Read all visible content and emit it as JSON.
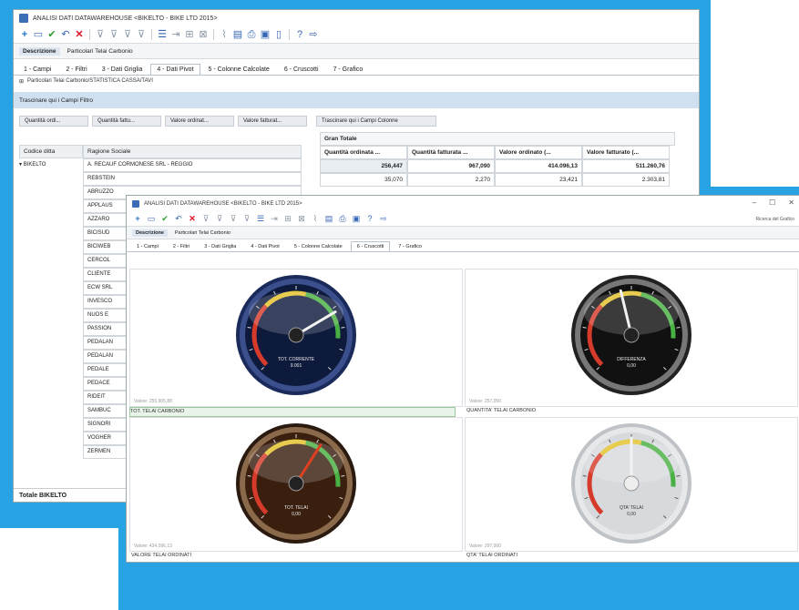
{
  "window1": {
    "title": "ANALISI DATI DATAWAREHOUSE <BIKELTO - BIKE LTD 2015>",
    "description_label": "Descrizione",
    "description_value": "Particolari Telai Carbonio",
    "tabs": [
      "1 - Campi",
      "2 - Filtri",
      "3 - Dati Griglia",
      "4 - Dati Pivot",
      "5 - Colonne Calcolate",
      "6 - Cruscotti",
      "7 - Grafico"
    ],
    "active_tab": 3,
    "info_line": "Particolari Telai Carbonio/STATISTICA CASSA/TAVI",
    "row_drop_zone": "Trascinare qui i Campi Filtro",
    "field_chips": [
      "Quantità ordi...",
      "Quantità fattu...",
      "Valore ordinat...",
      "Valore fatturat..."
    ],
    "column_drop_zone": "Trascinare qui i Campi Colonne",
    "row_headers": [
      "Codice ditta",
      "Ragione Sociale"
    ],
    "grand_total_label": "Gran Totale",
    "column_headers": [
      "Quantità ordinata ...",
      "Quantità fatturata ...",
      "Valore ordinato (...",
      "Valore fatturato (..."
    ],
    "group_label": "BIKELTO",
    "first_row_name": "A. RECAUF CORMONESE SRL - REGGIO",
    "first_row_values": [
      "256,447",
      "967,090",
      "414.096,13",
      "511.260,76"
    ],
    "second_row_values": [
      "35,070",
      "2,270",
      "23,421",
      "2.303,81"
    ],
    "customer_rows": [
      "REBSTEIN",
      "ABRUZZO",
      "APPLAUS",
      "AZZARO",
      "BICISUD",
      "BICIWEB",
      "CERCOL",
      "CLIENTE",
      "ECW SRL",
      "INVESCO",
      "NUOS E",
      "PASSION",
      "PEDALAN",
      "PEDALAN",
      "PEDALE",
      "PEDACE",
      "RIDEIT",
      "SAMBUC",
      "SIGNORI",
      "VOGHER",
      "ZERMEN"
    ],
    "total_label": "Totale BIKELTO"
  },
  "window2": {
    "title": "ANALISI DATI DATAWAREHOUSE <BIKELTO - BIKE LTD 2015>",
    "description_label": "Descrizione",
    "description_value": "Particolari Telai Carbonio",
    "tabs": [
      "1 - Campi",
      "2 - Filtri",
      "3 - Dati Griglia",
      "4 - Dati Pivot",
      "5 - Colonne Calcolate",
      "6 - Cruscotti",
      "7 - Grafico"
    ],
    "active_tab": 5,
    "right_search": "Ricerca del Grafico",
    "gauges": [
      {
        "style": "blue",
        "label": "TOT. CORRENTE",
        "value_text": "9.001",
        "caption": "TOT. TELAI CARBONIO",
        "small_value": "Valore: 255.905,88",
        "needle": 0.72
      },
      {
        "style": "black",
        "label": "DIFFERENZA",
        "value_text": "0,00",
        "caption": "QUANTITA' TELAI CARBONIO",
        "small_value": "Valore: 257,050",
        "needle": 0.45
      },
      {
        "style": "bronze",
        "label": "TOT. TELAI",
        "value_text": "0,00",
        "caption": "VALORE TELAI ORDINATI",
        "small_value": "Valore: 434.096,13",
        "needle": 0.62
      },
      {
        "style": "silver",
        "label": "QTA' TELAI",
        "value_text": "0,00",
        "caption": "QTA' TELAI ORDINATI",
        "small_value": "Valore: 297,000",
        "needle": 0.5
      }
    ]
  }
}
